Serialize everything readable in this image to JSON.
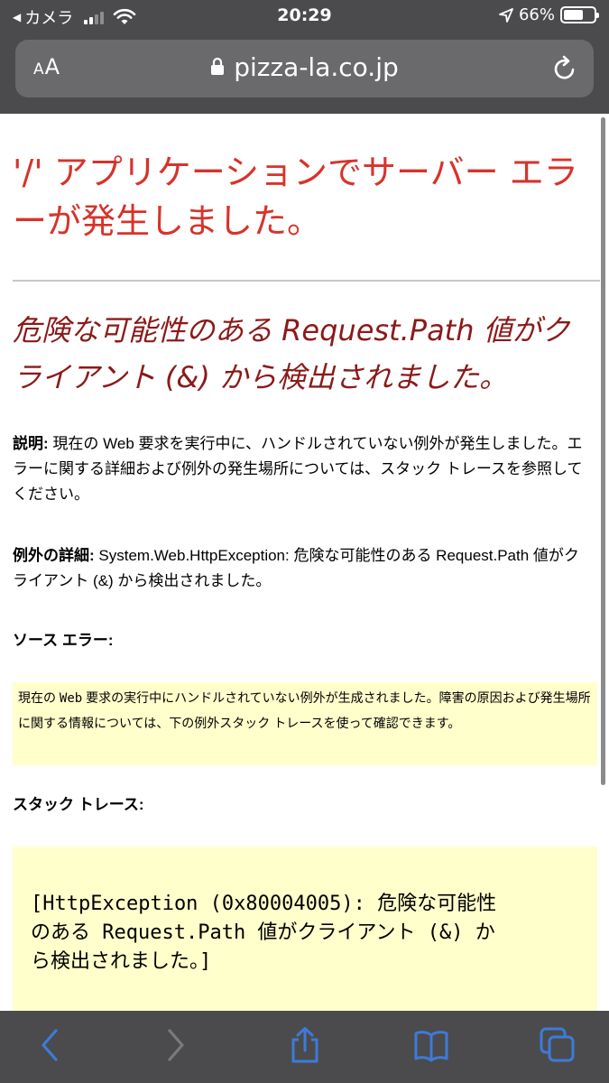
{
  "status_bar": {
    "carrier": "カメラ",
    "time": "20:29",
    "battery_text": "66%",
    "battery_level": 0.66,
    "signal_bars_filled": 2
  },
  "address_bar": {
    "aa_label": "AA",
    "url": "pizza-la.co.jp"
  },
  "page": {
    "title": "'/' アプリケーションでサーバー エラーが発生しました。",
    "subtitle": "危険な可能性のある Request.Path 値がクライアント (&) から検出されました。",
    "description_label": "説明:",
    "description_text": "現在の Web 要求を実行中に、ハンドルされていない例外が発生しました。エラーに関する詳細および例外の発生場所については、スタック トレースを参照してください。",
    "exception_label": "例外の詳細:",
    "exception_text": "System.Web.HttpException: 危険な可能性のある Request.Path 値がクライアント (&) から検出されました。",
    "source_error_label": "ソース エラー:",
    "source_box": {
      "part1": "現在の ",
      "mono": "Web",
      "part2": " 要求の実行中にハンドルされていない例外が生成されました。障害の原因および発生場所に関する情報については、下の例外スタック トレースを使って確認できます。"
    },
    "stack_trace_label": "スタック トレース:",
    "stack_trace_text": "[HttpException (0x80004005): 危険な可能性のある Request.Path 値がクライアント (&) から検出されました。]"
  },
  "colors": {
    "title": "#d7332a",
    "subtitle": "#8b1a1a",
    "highlight_box": "#ffffcc",
    "chrome": "#4b4b4d",
    "toolbar_icon": "#3d7bd9"
  },
  "toolbar": {
    "icons": [
      "back-icon",
      "forward-icon",
      "share-icon",
      "bookmarks-icon",
      "tabs-icon"
    ]
  }
}
